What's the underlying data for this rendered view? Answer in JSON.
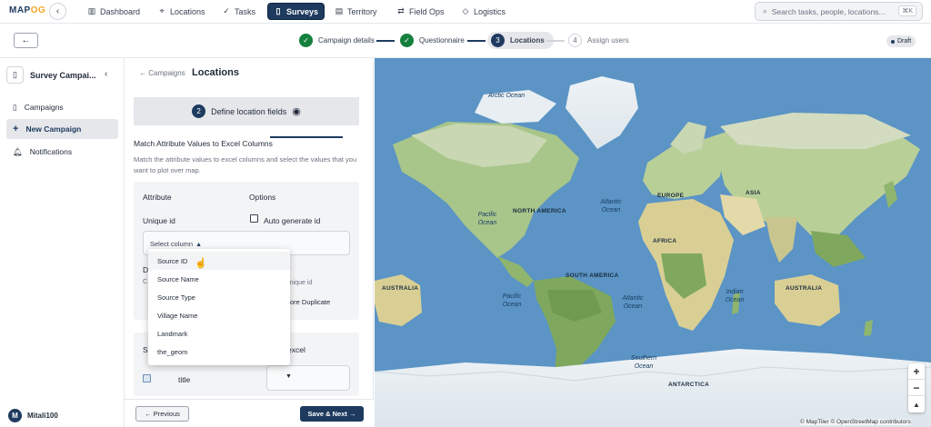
{
  "topbar": {
    "logo_main": "MAP",
    "logo_accent": "OG",
    "nav": [
      {
        "label": "Dashboard",
        "icon": "chart-icon"
      },
      {
        "label": "Locations",
        "icon": "pin-icon"
      },
      {
        "label": "Tasks",
        "icon": "check-icon"
      },
      {
        "label": "Surveys",
        "icon": "clipboard-icon",
        "active": true
      },
      {
        "label": "Territory",
        "icon": "map-icon"
      },
      {
        "label": "Field Ops",
        "icon": "route-icon"
      },
      {
        "label": "Logistics",
        "icon": "box-icon"
      }
    ],
    "search_placeholder": "Search tasks, people, locations...",
    "search_shortcut": "⌘K"
  },
  "steps": {
    "items": [
      {
        "num": "1",
        "label": "Campaign details",
        "state": "done"
      },
      {
        "num": "2",
        "label": "Questionnaire",
        "state": "done"
      },
      {
        "num": "3",
        "label": "Locations",
        "state": "current"
      },
      {
        "num": "4",
        "label": "Assign users",
        "state": "todo"
      }
    ],
    "status": "Draft"
  },
  "sidebar": {
    "title": "Survey Campai...",
    "items": [
      {
        "label": "Campaigns",
        "icon": "clipboard-icon"
      },
      {
        "label": "New Campaign",
        "icon": "plus-icon",
        "active": true
      },
      {
        "label": "Notifications",
        "icon": "bell-icon"
      }
    ],
    "user": {
      "initial": "M",
      "name": "Mitali100"
    }
  },
  "panel": {
    "crumb": "← Campaigns",
    "title": "Locations",
    "section_num": "2",
    "section_title": "Define location fields",
    "match_title": "Match Attribute Values to Excel Columns",
    "match_desc": "Match the attribute values to excel columns and select the values that you want to plot over map.",
    "col_attribute": "Attribute",
    "col_options": "Options",
    "unique_id_label": "Unique id",
    "auto_generate": "Auto generate id",
    "select_placeholder": "Select column",
    "hidden_d": "D",
    "hidden_c": "C",
    "partial_unique": "n unique id",
    "partial_duplicate": "ore Duplicate",
    "section2_se": "Se",
    "section2_excel": "excel",
    "title_field": "title",
    "prev_label": "← Previous",
    "next_label": "Save & Next →"
  },
  "dropdown": {
    "options": [
      "Source ID",
      "Source Name",
      "Source Type",
      "Village Name",
      "Landmark",
      "the_geom"
    ],
    "hovered": "Source ID"
  },
  "map": {
    "oceans": [
      {
        "name": "Arctic Ocean"
      },
      {
        "name": "Pacific Ocean"
      },
      {
        "name": "Atlantic Ocean"
      },
      {
        "name": "Indian Ocean"
      },
      {
        "name": "Pacific Ocean"
      },
      {
        "name": "Atlantic Ocean"
      },
      {
        "name": "Southern Ocean"
      }
    ],
    "continents": [
      "NORTH AMERICA",
      "EUROPE",
      "ASIA",
      "AFRICA",
      "SOUTH AMERICA",
      "AUSTRALIA",
      "AUSTRALIA",
      "ANTARCTICA"
    ],
    "zoom_in": "+",
    "zoom_out": "−",
    "compass": "▲",
    "attribution": "© MapTiler © OpenStreetMap contributors"
  }
}
